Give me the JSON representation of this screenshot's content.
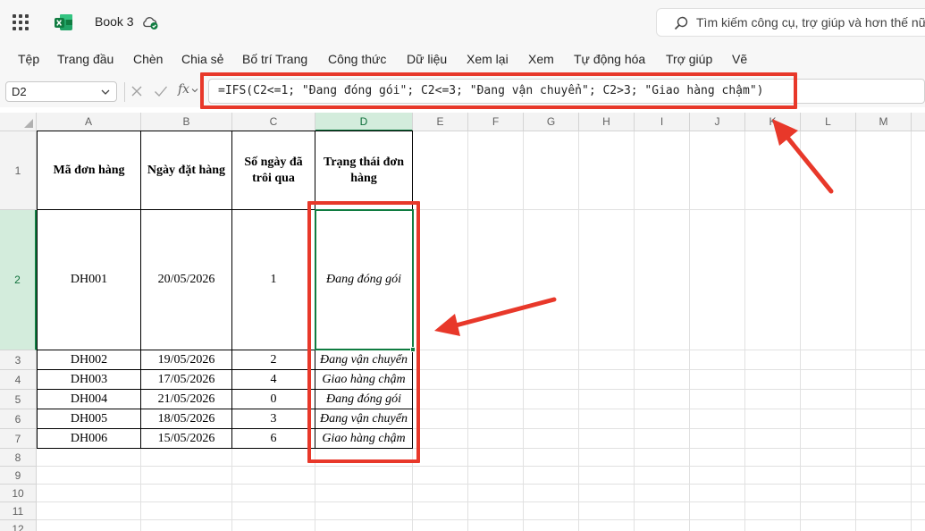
{
  "app": {
    "document_title": "Book 3",
    "search_placeholder": "Tìm kiếm công cụ, trợ giúp và hơn thế nữa"
  },
  "ribbon": {
    "tabs": [
      {
        "label": "Tệp"
      },
      {
        "label": "Trang đầu"
      },
      {
        "label": "Chèn"
      },
      {
        "label": "Chia sẻ"
      },
      {
        "label": "Bố trí Trang"
      },
      {
        "label": "Công thức"
      },
      {
        "label": "Dữ liệu"
      },
      {
        "label": "Xem lại"
      },
      {
        "label": "Xem"
      },
      {
        "label": "Tự động hóa"
      },
      {
        "label": "Trợ giúp"
      },
      {
        "label": "Vẽ"
      }
    ]
  },
  "formula_bar": {
    "name_box": "D2",
    "fx_label": "fx",
    "formula": "=IFS(C2<=1; \"Đang đóng gói\"; C2<=3; \"Đang vận chuyển\"; C2>3; \"Giao hàng chậm\")"
  },
  "sheet": {
    "columns": [
      "A",
      "B",
      "C",
      "D",
      "E",
      "F",
      "G",
      "H",
      "I",
      "J",
      "K",
      "L",
      "M"
    ],
    "rows": [
      "1",
      "2",
      "3",
      "4",
      "5",
      "6",
      "7",
      "8",
      "9",
      "10",
      "11",
      "12"
    ],
    "selected_column": "D",
    "selected_row": "2",
    "header": [
      "Mã đơn hàng",
      "Ngày đặt hàng",
      "Số ngày đã trôi qua",
      "Trạng thái đơn hàng"
    ],
    "data": [
      [
        "DH001",
        "20/05/2026",
        "1",
        "Đang đóng gói"
      ],
      [
        "DH002",
        "19/05/2026",
        "2",
        "Đang vận chuyển"
      ],
      [
        "DH003",
        "17/05/2026",
        "4",
        "Giao hàng chậm"
      ],
      [
        "DH004",
        "21/05/2026",
        "0",
        "Đang đóng gói"
      ],
      [
        "DH005",
        "18/05/2026",
        "3",
        "Đang vận chuyển"
      ],
      [
        "DH006",
        "15/05/2026",
        "6",
        "Giao hàng chậm"
      ]
    ]
  },
  "colors": {
    "accent": "#107c41",
    "annotation": "#e8382a"
  }
}
